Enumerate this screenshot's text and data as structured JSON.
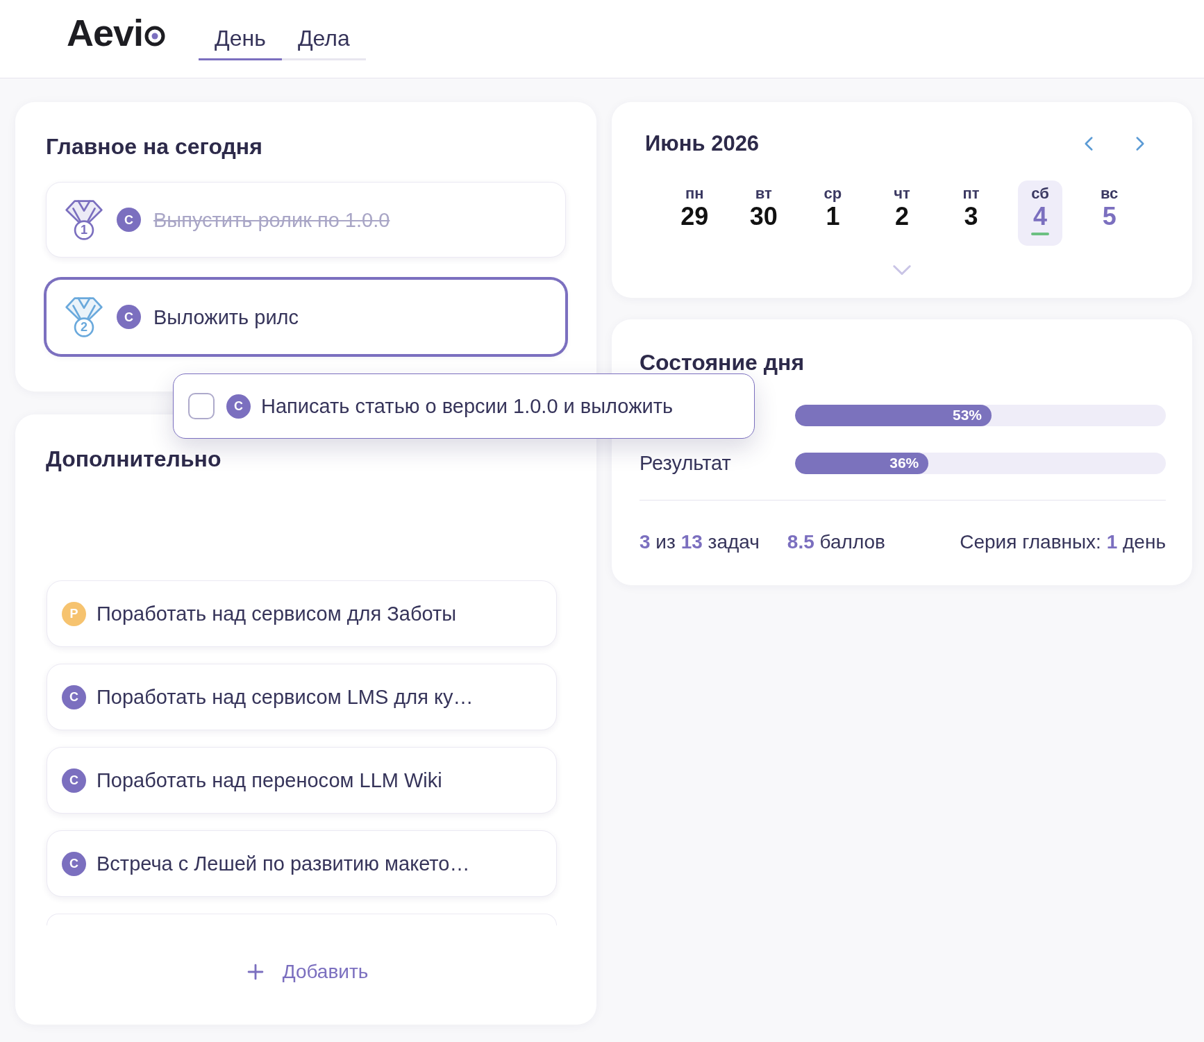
{
  "header": {
    "logo": "Aevi",
    "tabs": [
      {
        "label": "День",
        "selected": true
      },
      {
        "label": "Дела",
        "selected": false
      }
    ]
  },
  "main_today": {
    "title": "Главное на сегодня",
    "items": [
      {
        "medal": {
          "rank": "1",
          "color": "#7b6fbf"
        },
        "badge": {
          "letter": "С",
          "color": "#7b6fbf"
        },
        "text": "Выпустить ролик по 1.0.0",
        "done": true,
        "selected": false
      },
      {
        "medal": {
          "rank": "2",
          "color": "#6aa9dc"
        },
        "badge": {
          "letter": "С",
          "color": "#7b6fbf"
        },
        "text": "Выложить рилс",
        "done": false,
        "selected": true
      }
    ]
  },
  "dragged_item": {
    "checked": false,
    "badge": {
      "letter": "С",
      "color": "#7b6fbf"
    },
    "text": "Написать статью о версии 1.0.0 и выложить"
  },
  "additional": {
    "title": "Дополнительно",
    "items": [
      {
        "badge": {
          "letter": "Р",
          "color": "#f6c36f"
        },
        "text": "Поработать над сервисом для Заботы"
      },
      {
        "badge": {
          "letter": "С",
          "color": "#7b6fbf"
        },
        "text": "Поработать над сервисом LMS для ку…"
      },
      {
        "badge": {
          "letter": "С",
          "color": "#7b6fbf"
        },
        "text": "Поработать над переносом LLM Wiki"
      },
      {
        "badge": {
          "letter": "С",
          "color": "#7b6fbf"
        },
        "text": "Встреча с Лешей по развитию макето…"
      }
    ],
    "more_below": true,
    "add_button": "Добавить"
  },
  "calendar": {
    "title": "Июнь 2026",
    "days": [
      {
        "weekday": "пн",
        "date": "29",
        "selected": false,
        "weekend": false,
        "today": false
      },
      {
        "weekday": "вт",
        "date": "30",
        "selected": false,
        "weekend": false,
        "today": false
      },
      {
        "weekday": "ср",
        "date": "1",
        "selected": false,
        "weekend": false,
        "today": false
      },
      {
        "weekday": "чт",
        "date": "2",
        "selected": false,
        "weekend": false,
        "today": false
      },
      {
        "weekday": "пт",
        "date": "3",
        "selected": false,
        "weekend": false,
        "today": false
      },
      {
        "weekday": "сб",
        "date": "4",
        "selected": true,
        "weekend": true,
        "today": true
      },
      {
        "weekday": "вс",
        "date": "5",
        "selected": false,
        "weekend": true,
        "today": false
      }
    ]
  },
  "day_state": {
    "title": "Состояние дня",
    "bars": [
      {
        "level": 0.53,
        "value": "53%"
      },
      {
        "label": "Результат",
        "level": 0.36,
        "value": "36%"
      }
    ],
    "stats": [
      "**3** из **13** задач",
      "**8.5** баллов",
      "Серия главных: **1** день"
    ]
  }
}
